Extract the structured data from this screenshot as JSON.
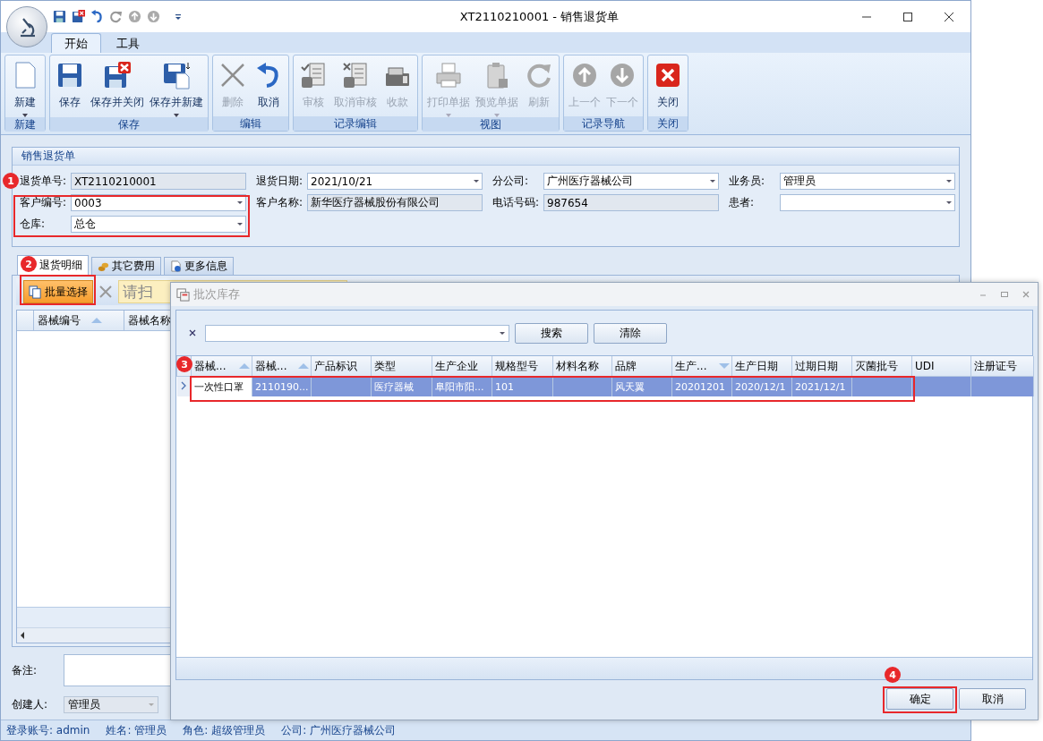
{
  "window": {
    "title": "XT2110210001 - 销售退货单"
  },
  "ribbon_tabs": [
    {
      "label": "开始",
      "selected": true
    },
    {
      "label": "工具",
      "selected": false
    }
  ],
  "ribbon_groups": [
    {
      "label": "新建",
      "buttons": [
        {
          "label": "新建",
          "disabled": false,
          "dropdown": true
        }
      ]
    },
    {
      "label": "保存",
      "buttons": [
        {
          "label": "保存",
          "disabled": false,
          "dropdown": false
        },
        {
          "label": "保存并关闭",
          "disabled": false,
          "dropdown": false
        },
        {
          "label": "保存并新建",
          "disabled": false,
          "dropdown": true
        }
      ]
    },
    {
      "label": "编辑",
      "buttons": [
        {
          "label": "删除",
          "disabled": true,
          "dropdown": false
        },
        {
          "label": "取消",
          "disabled": false,
          "dropdown": false
        }
      ]
    },
    {
      "label": "记录编辑",
      "buttons": [
        {
          "label": "审核",
          "disabled": true,
          "dropdown": false
        },
        {
          "label": "取消审核",
          "disabled": true,
          "dropdown": false
        },
        {
          "label": "收款",
          "disabled": true,
          "dropdown": false
        }
      ]
    },
    {
      "label": "视图",
      "buttons": [
        {
          "label": "打印单据",
          "disabled": true,
          "dropdown": true
        },
        {
          "label": "预览单据",
          "disabled": true,
          "dropdown": true
        },
        {
          "label": "刷新",
          "disabled": true,
          "dropdown": false
        }
      ]
    },
    {
      "label": "记录导航",
      "buttons": [
        {
          "label": "上一个",
          "disabled": true,
          "dropdown": false
        },
        {
          "label": "下一个",
          "disabled": true,
          "dropdown": false
        }
      ]
    },
    {
      "label": "关闭",
      "buttons": [
        {
          "label": "关闭",
          "disabled": false,
          "dropdown": false
        }
      ]
    }
  ],
  "form": {
    "title": "销售退货单",
    "fields": [
      {
        "label": "退货单号:",
        "value": "XT2110210001",
        "kind": "readonly"
      },
      {
        "label": "退货日期:",
        "value": "2021/10/21",
        "kind": "combo"
      },
      {
        "label": "分公司:",
        "value": "广州医疗器械公司",
        "kind": "combo"
      },
      {
        "label": "业务员:",
        "value": "管理员",
        "kind": "combo"
      },
      {
        "label": "客户编号:",
        "value": "0003",
        "kind": "combo"
      },
      {
        "label": "客户名称:",
        "value": "新华医疗器械股份有限公司",
        "kind": "readonly"
      },
      {
        "label": "电话号码:",
        "value": "987654",
        "kind": "readonly"
      },
      {
        "label": "患者:",
        "kind": "combo"
      },
      {
        "label": "仓库:",
        "value": "总仓",
        "kind": "combo"
      }
    ]
  },
  "detail_tabs": [
    {
      "label": "退货明细",
      "selected": true
    },
    {
      "label": "其它费用",
      "selected": false
    },
    {
      "label": "更多信息",
      "selected": false
    }
  ],
  "detail_toolbar": {
    "batch_button": "批量选择",
    "scan_placeholder": "请扫"
  },
  "detail_grid": {
    "columns": [
      "器械编号",
      "器械名称"
    ]
  },
  "remark": {
    "label": "备注:"
  },
  "creator": {
    "label": "创建人:",
    "value": "管理员"
  },
  "status_bar": [
    "登录账号: admin",
    "姓名: 管理员",
    "角色: 超级管理员",
    "公司: 广州医疗器械公司"
  ],
  "dialog": {
    "title": "批次库存",
    "search_button": "搜索",
    "clear_button": "清除",
    "columns": [
      {
        "label": "器械...",
        "sort_asc": true,
        "sort_desc": false
      },
      {
        "label": "器械...",
        "sort_asc": true,
        "sort_desc": false
      },
      {
        "label": "产品标识",
        "sort_asc": false,
        "sort_desc": false
      },
      {
        "label": "类型",
        "sort_asc": false,
        "sort_desc": false
      },
      {
        "label": "生产企业",
        "sort_asc": false,
        "sort_desc": false
      },
      {
        "label": "规格型号",
        "sort_asc": false,
        "sort_desc": false
      },
      {
        "label": "材料名称",
        "sort_asc": false,
        "sort_desc": false
      },
      {
        "label": "品牌",
        "sort_asc": false,
        "sort_desc": false
      },
      {
        "label": "生产...",
        "sort_asc": false,
        "sort_desc": true
      },
      {
        "label": "生产日期",
        "sort_asc": false,
        "sort_desc": false
      },
      {
        "label": "过期日期",
        "sort_asc": false,
        "sort_desc": false
      },
      {
        "label": "灭菌批号",
        "sort_asc": false,
        "sort_desc": false
      },
      {
        "label": "UDI",
        "sort_asc": false,
        "sort_desc": false
      },
      {
        "label": "注册证号",
        "sort_asc": false,
        "sort_desc": false
      }
    ],
    "rows": [
      {
        "selected": true,
        "cells": [
          {
            "text": "一次性口罩",
            "focused": true
          },
          {
            "text": "2110190...",
            "focused": false
          },
          {
            "focused": false
          },
          {
            "text": "医疗器械",
            "focused": false
          },
          {
            "text": "阜阳市阳...",
            "focused": false
          },
          {
            "text": "101",
            "focused": false
          },
          {
            "focused": false
          },
          {
            "text": "风天翼",
            "focused": false
          },
          {
            "text": "20201201",
            "focused": false
          },
          {
            "text": "2020/12/1",
            "focused": false
          },
          {
            "text": "2021/12/1",
            "focused": false
          },
          {
            "focused": false
          },
          {
            "focused": false
          },
          {
            "focused": false
          }
        ]
      }
    ],
    "ok_button": "确定",
    "cancel_button": "取消"
  },
  "annotations": [
    {
      "number": "1"
    },
    {
      "number": "2"
    },
    {
      "number": "3"
    },
    {
      "number": "4"
    }
  ]
}
